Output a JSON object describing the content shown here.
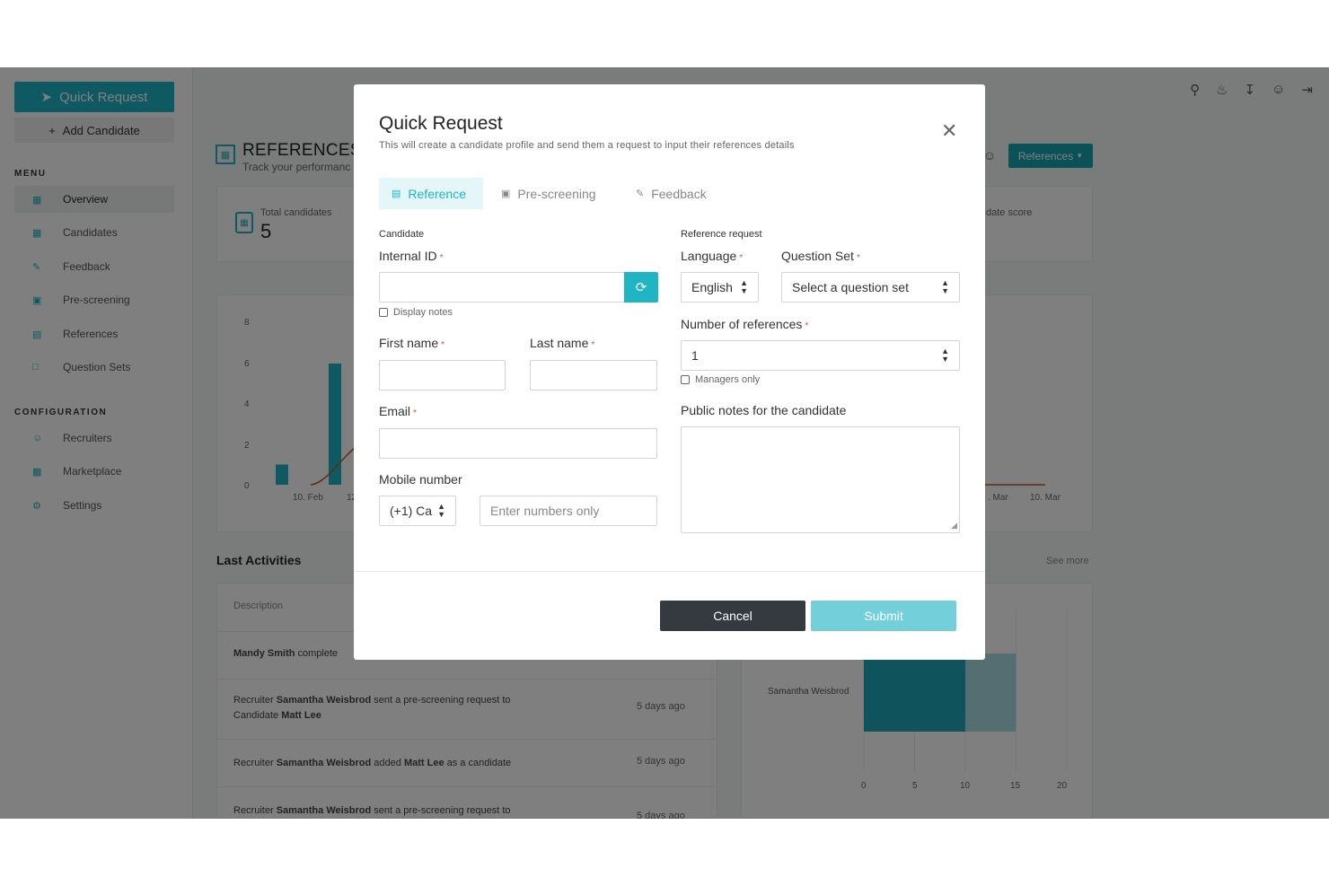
{
  "colors": {
    "accent": "#1fb5c5",
    "dark_button": "#343a40",
    "submit_disabled": "#73d0da",
    "required": "#e74c3c"
  },
  "sidebar": {
    "quick_request": "Quick Request",
    "add_candidate": "Add Candidate",
    "menu_heading": "MENU",
    "menu_items": [
      {
        "label": "Overview",
        "icon": "chart-icon"
      },
      {
        "label": "Candidates",
        "icon": "clipboard-icon"
      },
      {
        "label": "Feedback",
        "icon": "thumbs-up-icon"
      },
      {
        "label": "Pre-screening",
        "icon": "camera-icon"
      },
      {
        "label": "References",
        "icon": "document-icon"
      },
      {
        "label": "Question Sets",
        "icon": "chat-icon"
      }
    ],
    "config_heading": "CONFIGURATION",
    "config_items": [
      {
        "label": "Recruiters",
        "icon": "users-icon"
      },
      {
        "label": "Marketplace",
        "icon": "store-icon"
      },
      {
        "label": "Settings",
        "icon": "gear-icon"
      }
    ]
  },
  "header": {
    "title": "REFERENCES C",
    "subtitle": "Track your performanc",
    "references_dropdown": "References"
  },
  "stats": {
    "total_candidates_label": "Total candidates",
    "total_candidates_value": "5",
    "date_score_label": "date score"
  },
  "chart_data": {
    "type": "bar",
    "y_ticks": [
      "8",
      "6",
      "4",
      "2",
      "0"
    ],
    "x_ticks_left": [
      "10. Feb",
      "12"
    ],
    "x_ticks_right": [
      ". Mar",
      "10. Mar"
    ],
    "bar_values": [
      1,
      6
    ],
    "ylim": [
      0,
      8
    ],
    "line_color": "#c0561f"
  },
  "activities": {
    "heading": "Last Activities",
    "see_more": "See more",
    "column_description": "Description",
    "rows": [
      {
        "pre": "",
        "bold1": "Mandy Smith",
        "mid": " complete",
        "bold2": "",
        "post": "",
        "line2": "",
        "time": ""
      },
      {
        "pre": "Recruiter ",
        "bold1": "Samantha Weisbrod",
        "mid": " sent a pre-screening request to",
        "bold2": "",
        "post": "",
        "line2": "Candidate ",
        "line2_bold": "Matt Lee",
        "time": "5 days ago"
      },
      {
        "pre": "Recruiter ",
        "bold1": "Samantha Weisbrod",
        "mid": " added ",
        "bold2": "Matt Lee",
        "post": " as a candidate",
        "line2": "",
        "time": "5 days ago"
      },
      {
        "pre": "Recruiter ",
        "bold1": "Samantha Weisbrod",
        "mid": " sent a pre-screening request to",
        "bold2": "",
        "post": "",
        "line2": "",
        "time": "5 days ago"
      }
    ]
  },
  "bar_chart2": {
    "category": "Samantha Weisbrod",
    "x_ticks": [
      "0",
      "5",
      "10",
      "15",
      "20"
    ],
    "values": [
      10,
      15
    ],
    "xlim": [
      0,
      20
    ]
  },
  "modal": {
    "title": "Quick Request",
    "subtitle": "This will create a candidate profile and send them a request to input their references details",
    "tabs": [
      {
        "label": "Reference",
        "icon": "document-icon",
        "active": true
      },
      {
        "label": "Pre-screening",
        "icon": "camera-icon",
        "active": false
      },
      {
        "label": "Feedback",
        "icon": "thumbs-up-icon",
        "active": false
      }
    ],
    "candidate_section": "Candidate",
    "internal_id_label": "Internal ID",
    "display_notes": "Display notes",
    "first_name_label": "First name",
    "last_name_label": "Last name",
    "email_label": "Email",
    "mobile_label": "Mobile number",
    "country_code": "(+1) Ca",
    "mobile_placeholder": "Enter numbers only",
    "reference_section": "Reference request",
    "language_label": "Language",
    "language_value": "English",
    "question_set_label": "Question Set",
    "question_set_value": "Select a question set",
    "num_refs_label": "Number of references",
    "num_refs_value": "1",
    "managers_only": "Managers only",
    "public_notes_label": "Public notes for the candidate",
    "required_mark": "*",
    "cancel": "Cancel",
    "submit": "Submit"
  }
}
